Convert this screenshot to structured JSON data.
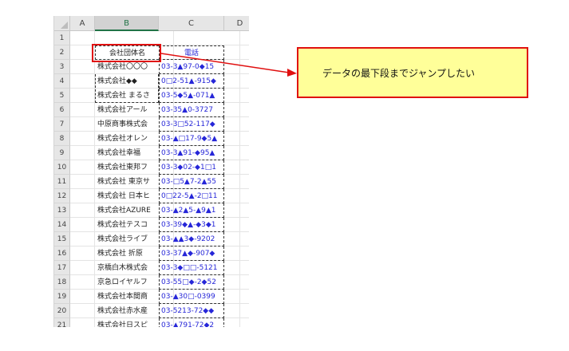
{
  "columns": [
    "A",
    "B",
    "C",
    "D"
  ],
  "rows": [
    "1",
    "2",
    "3",
    "4",
    "5",
    "6",
    "7",
    "8",
    "9",
    "10",
    "11",
    "12",
    "13",
    "14",
    "15",
    "16",
    "17",
    "18",
    "19",
    "20",
    "21"
  ],
  "table": {
    "header_company": "会社団体名",
    "header_phone": "電話",
    "entries": [
      {
        "company": "株式会社〇〇〇",
        "phone": "03-3▲97-0◆15"
      },
      {
        "company": "株式会社◆◆",
        "phone": "0□2-51▲-915◆"
      },
      {
        "company": "株式会社 まるさ",
        "phone": "03-5◆5▲-071▲"
      },
      {
        "company": "株式会社アール",
        "phone": "03-35▲0-3727"
      },
      {
        "company": "中原商事株式会",
        "phone": "03-3□52-117◆"
      },
      {
        "company": "株式会社オレン",
        "phone": "03-▲□17-9◆5▲"
      },
      {
        "company": "株式会社幸福",
        "phone": "03-3▲91-◆95▲"
      },
      {
        "company": "株式会社東邦フ",
        "phone": "03-3◆02-◆1□1"
      },
      {
        "company": "株式会社 東京サ",
        "phone": "03-□5▲7-2▲55"
      },
      {
        "company": "株式会社 日本ヒ",
        "phone": "0□22-5▲-2□11"
      },
      {
        "company": "株式会社AZURE",
        "phone": "03-▲2▲5-▲9▲1"
      },
      {
        "company": "株式会社テスコ",
        "phone": "03-39◆▲-◆3◆1"
      },
      {
        "company": "株式会社ライブ",
        "phone": "03-▲▲3◆-9202"
      },
      {
        "company": "株式会社 折原",
        "phone": "03-37▲◆-907◆"
      },
      {
        "company": "京橋白木株式会",
        "phone": "03-3◆□□-5121"
      },
      {
        "company": "京急ロイヤルフ",
        "phone": "03-55□◆-2◆52"
      },
      {
        "company": "株式会社本間商",
        "phone": "03-▲30□-0399"
      },
      {
        "company": "株式会社赤水産",
        "phone": "03-5213-72◆◆"
      },
      {
        "company": "株式会社日スピ",
        "phone": "03-▲791-72◆2"
      }
    ]
  },
  "callout": {
    "text": "データの最下段までジャンプしたい"
  },
  "colors": {
    "highlight_border": "#e01010",
    "callout_fill": "#ffff99",
    "phone_text": "#2626d8"
  }
}
